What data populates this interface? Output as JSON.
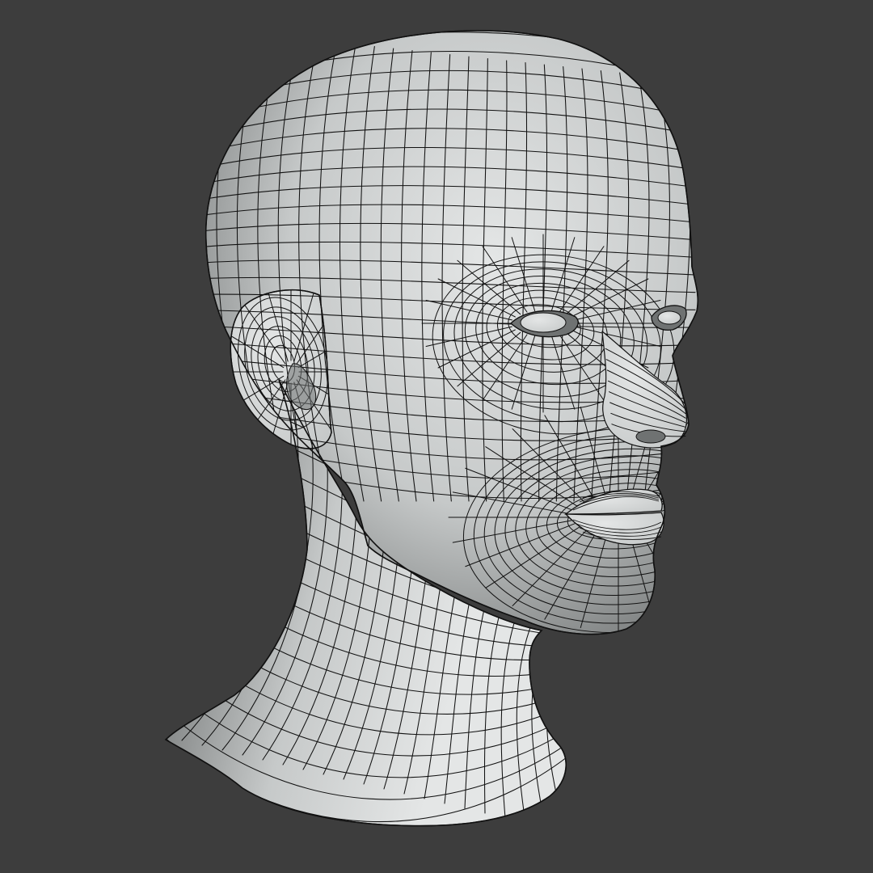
{
  "viewport": {
    "background_color": "#3d3d3d",
    "surface_color": "#c6c9c9",
    "surface_highlight": "#e4e6e6",
    "surface_shadow": "#6f7272",
    "wire_color": "#111111"
  },
  "model": {
    "shading": "solid",
    "overlay": "wireframe",
    "subject": "head-and-neck-base-mesh"
  }
}
